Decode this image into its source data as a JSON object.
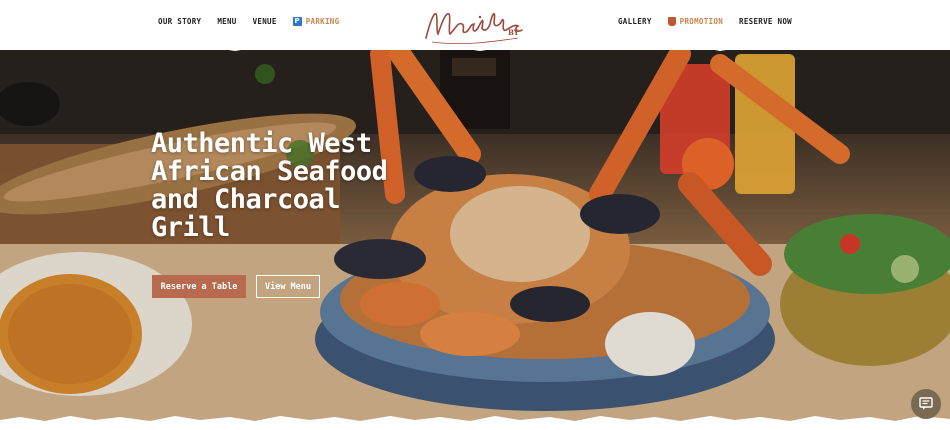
{
  "nav": {
    "left": [
      {
        "label": "OUR STORY"
      },
      {
        "label": "MENU"
      },
      {
        "label": "VENUE"
      },
      {
        "label": "PARKING"
      }
    ],
    "right": [
      {
        "label": "GALLERY"
      },
      {
        "label": "PROMOTION"
      },
      {
        "label": "RESERVE NOW"
      }
    ]
  },
  "logo": {
    "text": "Monika",
    "sub": "BY"
  },
  "hero": {
    "title": "Authentic West African Seafood and Charcoal Grill",
    "primary_button": "Reserve a Table",
    "secondary_button": "View Menu"
  },
  "colors": {
    "accent": "#c9854c",
    "brand": "#9b4a3c",
    "button": "#b86a4e"
  },
  "icons": {
    "parking": "parking-icon",
    "promotion": "tag-icon",
    "chat": "chat-icon"
  }
}
